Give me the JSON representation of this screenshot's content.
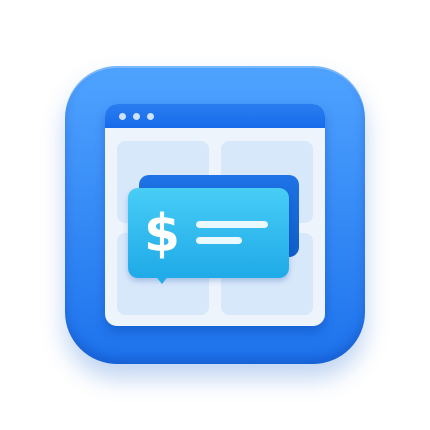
{
  "icon": {
    "glyph": "$",
    "name": "dollar-sign-icon"
  }
}
